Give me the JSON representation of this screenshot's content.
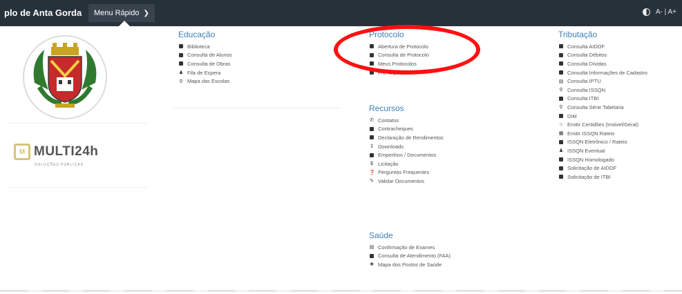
{
  "header": {
    "site_name": "plo de Anta Gorda",
    "menu_label": "Menu Rápido",
    "font_size_label": "A- | A+"
  },
  "brand": {
    "multi_name": "MULTI24h",
    "multi_subtitle": "SOLUÇÕES PÚBLICAS"
  },
  "educacao": {
    "title": "Educação",
    "items": [
      {
        "label": "Biblioteca",
        "icon": "building-icon"
      },
      {
        "label": "Consulta de Alunos",
        "icon": "building-icon"
      },
      {
        "label": "Consulta de Obras",
        "icon": "building-icon"
      },
      {
        "label": "Fila de Espera",
        "icon": "person-icon"
      },
      {
        "label": "Mapa das Escolas",
        "icon": "map-pin-icon"
      }
    ]
  },
  "protocolo": {
    "title": "Protocolo",
    "items": [
      {
        "label": "Abertura de Protocolo",
        "icon": "building-icon"
      },
      {
        "label": "Consulta de Protocolo",
        "icon": "building-icon"
      },
      {
        "label": "Meus Protocolos",
        "icon": "building-icon"
      },
      {
        "label": "Pré-requisitos",
        "icon": "building-icon"
      }
    ]
  },
  "recursos": {
    "title": "Recursos",
    "items": [
      {
        "label": "Contatos",
        "icon": "phone-icon"
      },
      {
        "label": "Contracheques",
        "icon": "building-icon"
      },
      {
        "label": "Declaração de Rendimentos",
        "icon": "building-icon"
      },
      {
        "label": "Downloads",
        "icon": "download-icon"
      },
      {
        "label": "Empenhos / Documentos",
        "icon": "building-icon"
      },
      {
        "label": "Licitação",
        "icon": "dollar-icon"
      },
      {
        "label": "Perguntas Frequentes",
        "icon": "question-icon"
      },
      {
        "label": "Validar Documentos",
        "icon": "pencil-icon"
      }
    ]
  },
  "saude": {
    "title": "Saúde",
    "items": [
      {
        "label": "Confirmação de Exames",
        "icon": "document-icon"
      },
      {
        "label": "Consulta de Atendimento (FAA)",
        "icon": "building-icon"
      },
      {
        "label": "Mapa dos Postos de Saúde",
        "icon": "cross-icon"
      }
    ]
  },
  "tributacao": {
    "title": "Tributação",
    "items": [
      {
        "label": "Consulta AIDOF",
        "icon": "building-icon"
      },
      {
        "label": "Consulta Débitos",
        "icon": "building-icon"
      },
      {
        "label": "Consulta Dívidas",
        "icon": "building-icon"
      },
      {
        "label": "Consulta Informações de Cadastro",
        "icon": "building-icon"
      },
      {
        "label": "Consulta IPTU",
        "icon": "document-icon"
      },
      {
        "label": "Consulta ISSQN",
        "icon": "search-icon"
      },
      {
        "label": "Consulta ITBI",
        "icon": "building-icon"
      },
      {
        "label": "Consulta Série Tabelaria",
        "icon": "search-icon"
      },
      {
        "label": "DIM",
        "icon": "building-icon"
      },
      {
        "label": "Emitir Certidões (Imóvel/Geral)",
        "icon": "home-icon"
      },
      {
        "label": "Emitir ISSQN Rateio",
        "icon": "grid-icon"
      },
      {
        "label": "ISSQN Eletrônico / Rateio",
        "icon": "building-icon"
      },
      {
        "label": "ISSQN Eventual",
        "icon": "users-icon"
      },
      {
        "label": "ISSQN Homologado",
        "icon": "building-icon"
      },
      {
        "label": "Solicitação de AIDOF",
        "icon": "building-icon"
      },
      {
        "label": "Solicitação de ITBI",
        "icon": "building-icon"
      }
    ]
  },
  "colors": {
    "topbar": "#27313a",
    "title_blue": "#3f7fb8",
    "annotation_red": "#ff1010"
  }
}
